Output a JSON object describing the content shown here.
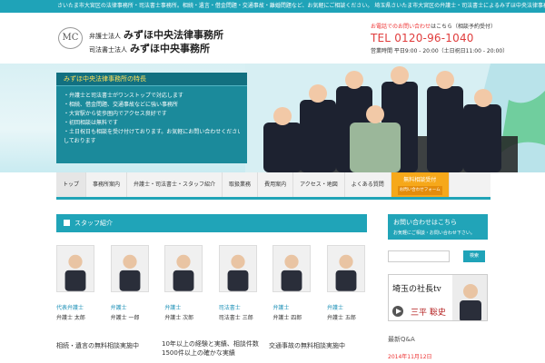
{
  "topbar": {
    "text": "さいたま市大宮区の法律事務所・司法書士事務所。相続・遺言・借金問題・交通事故・離婚問題など、お気軽にご相談ください。 埼玉県さいたま市大宮区の弁護士・司法書士によるみずほ中央法律事務所・みずほ中央事務所"
  },
  "header": {
    "logo_text": "MC",
    "firm1_prefix": "弁護士法人",
    "firm1_name": "みずほ中央法律事務所",
    "firm2_prefix": "司法書士法人",
    "firm2_name": "みずほ中央事務所",
    "contact_label": "お電話でのお問い合わせ",
    "contact_label_rest": "はこちら（相談予約受付）",
    "tel": "TEL 0120-96-1040",
    "hours": "営業時間 平日9:00 - 20:00（土日祝日11:00 - 20:00）"
  },
  "hero": {
    "panel_title": "みずほ中央法律事務所の特長",
    "lines": [
      "・弁護士と司法書士がワンストップで対応します",
      "・相続、借金問題、交通事故などに強い事務所",
      "・大宮駅から徒歩圏内でアクセス良好です",
      "・初回相談は無料です",
      "・土日祝日も相談を受け付けております。お気軽にお問い合わせください。ご来所をお待ちしております",
      "しております"
    ]
  },
  "nav": {
    "items": [
      "トップ",
      "事務所案内",
      "弁護士・司法書士・スタッフ紹介",
      "取扱業務",
      "費用案内",
      "アクセス・地図",
      "よくある質問"
    ],
    "special_label": "無料相談受付",
    "special_sub": "お問い合わせフォーム"
  },
  "greeting": {
    "title": "スタッフ紹介"
  },
  "staff": [
    {
      "role": "代表弁護士",
      "name": "弁護士 太郎"
    },
    {
      "role": "弁護士",
      "name": "弁護士 一郎"
    },
    {
      "role": "弁護士",
      "name": "弁護士 次郎"
    },
    {
      "role": "司法書士",
      "name": "司法書士 三郎"
    },
    {
      "role": "弁護士",
      "name": "弁護士 四郎"
    },
    {
      "role": "弁護士",
      "name": "弁護士 五郎"
    }
  ],
  "columns": [
    {
      "title": "相続・遺言の無料相談実施中"
    },
    {
      "title": "10年以上の経験と実績、相談件数1500件以上の確かな実績"
    },
    {
      "title": "交通事故の無料相談実施中"
    }
  ],
  "sidebar": {
    "contact_title": "お問い合わせはこちら",
    "contact_sub": "お気軽にご相談・お問い合わせ下さい。",
    "search_button": "検索",
    "banner_text": "埼玉の社長tv",
    "banner_name": "三平 聡史",
    "qa_title": "最新Q&A",
    "qa_date": "2014年11月12日"
  },
  "colors": {
    "brand": "#1fa3b8",
    "accent": "#e03c3c",
    "orange": "#f6a81a"
  }
}
